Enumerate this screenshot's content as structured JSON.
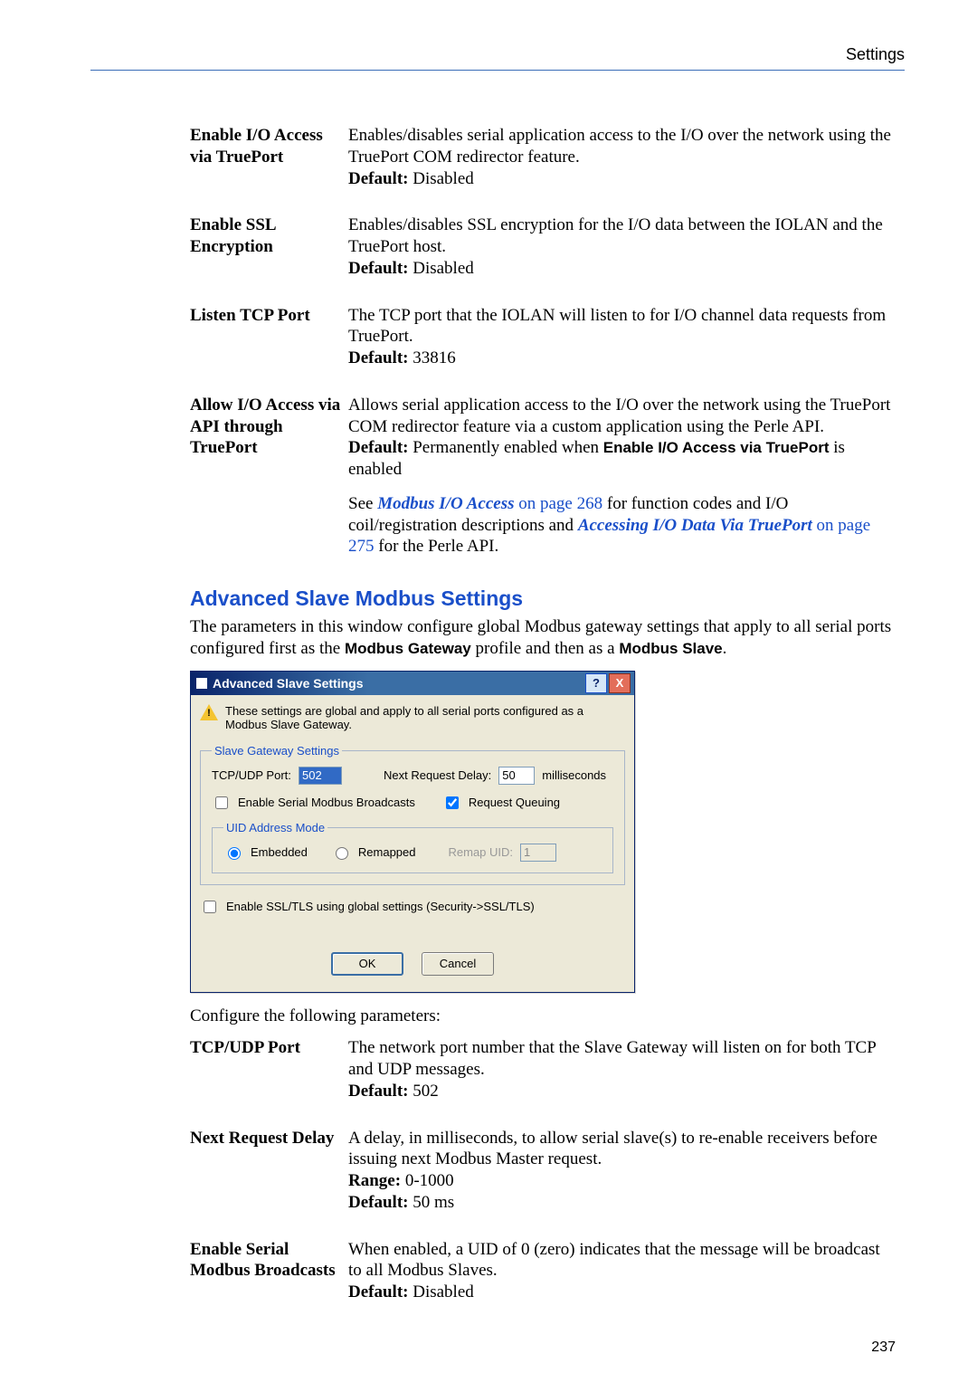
{
  "header": {
    "right": "Settings"
  },
  "defs1": [
    {
      "term": "Enable I/O Access via TruePort",
      "desc": "Enables/disables serial application access to the I/O over the network using the TruePort COM redirector feature.",
      "default_label": "Default:",
      "default_value": " Disabled"
    },
    {
      "term": "Enable SSL Encryption",
      "desc": "Enables/disables SSL encryption for the I/O data between the IOLAN and the TruePort host.",
      "default_label": "Default:",
      "default_value": " Disabled"
    },
    {
      "term": "Listen TCP Port",
      "desc": "The TCP port that the IOLAN will listen to for I/O channel data requests from TruePort.",
      "default_label": "Default:",
      "default_value": " 33816"
    }
  ],
  "defs1_complex": {
    "term": "Allow I/O Access via API through TruePort",
    "desc": "Allows serial application access to the I/O over the network using the TruePort COM redirector feature via a custom application using the Perle API.",
    "default_label": "Default:",
    "default_text_a": " Permanently enabled when ",
    "default_bold": "Enable I/O Access via TruePort",
    "default_text_b": " is enabled",
    "see_a": "See ",
    "link1": "Modbus I/O Access",
    "see_b": " on page 268",
    "see_c": " for function codes and I/O coil/registration descriptions and ",
    "link2": "Accessing I/O Data Via TruePort",
    "see_d": " on page 275",
    "see_e": " for the Perle API."
  },
  "section": {
    "title": "Advanced Slave Modbus Settings",
    "intro_a": "The parameters in this window configure global Modbus gateway settings that apply to all serial ports configured first as the ",
    "intro_b": "Modbus Gateway",
    "intro_c": " profile and then as a ",
    "intro_d": "Modbus Slave",
    "intro_e": "."
  },
  "dialog": {
    "title": "Advanced Slave Settings",
    "help": "?",
    "close": "X",
    "note": "These settings are global and apply to all serial ports configured as a Modbus Slave Gateway.",
    "grp1_legend": "Slave Gateway Settings",
    "tcpudp_label": "TCP/UDP Port:",
    "tcpudp_value": "502",
    "nextreq_label": "Next Request Delay:",
    "nextreq_value": "50",
    "ms": "milliseconds",
    "cb_broadcast": "Enable Serial Modbus Broadcasts",
    "cb_queue": "Request Queuing",
    "grp2_legend": "UID Address Mode",
    "rb_embedded": "Embedded",
    "rb_remapped": "Remapped",
    "remap_label": "Remap UID:",
    "remap_value": "1",
    "cb_ssl": "Enable SSL/TLS using global settings (Security->SSL/TLS)",
    "ok": "OK",
    "cancel": "Cancel"
  },
  "configure_text": "Configure the following parameters:",
  "defs2": [
    {
      "term": "TCP/UDP Port",
      "desc": "The network port number that the Slave Gateway will listen on for both TCP and UDP messages.",
      "extras": [
        {
          "b": "Default:",
          "t": " 502"
        }
      ]
    },
    {
      "term": "Next Request Delay",
      "term_inline": true,
      "desc": "A delay, in milliseconds, to allow serial slave(s) to re-enable receivers before issuing next Modbus Master request.",
      "extras": [
        {
          "b": "Range:",
          "t": " 0-1000"
        },
        {
          "b": "Default:",
          "t": " 50 ms"
        }
      ]
    },
    {
      "term": "Enable Serial Modbus Broadcasts",
      "desc": "When enabled, a UID of 0 (zero) indicates that the message will be broadcast to all Modbus Slaves.",
      "extras": [
        {
          "b": "Default:",
          "t": " Disabled"
        }
      ]
    }
  ],
  "page_number": "237"
}
